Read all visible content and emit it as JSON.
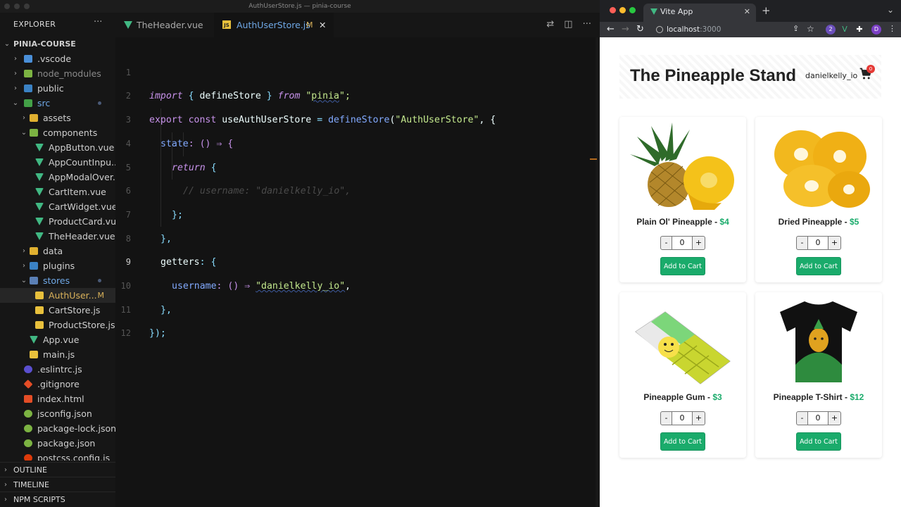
{
  "vscode": {
    "window_title": "AuthUserStore.js — pinia-course",
    "explorer_title": "EXPLORER",
    "project": "PINIA-COURSE",
    "tree": [
      {
        "label": ".vscode"
      },
      {
        "label": "node_modules"
      },
      {
        "label": "public"
      },
      {
        "label": "src"
      },
      {
        "label": "assets"
      },
      {
        "label": "components"
      },
      {
        "label": "AppButton.vue"
      },
      {
        "label": "AppCountInpu..."
      },
      {
        "label": "AppModalOver..."
      },
      {
        "label": "CartItem.vue"
      },
      {
        "label": "CartWidget.vue"
      },
      {
        "label": "ProductCard.vue"
      },
      {
        "label": "TheHeader.vue"
      },
      {
        "label": "data"
      },
      {
        "label": "plugins"
      },
      {
        "label": "stores"
      },
      {
        "label": "AuthUser...",
        "badge": "M"
      },
      {
        "label": "CartStore.js"
      },
      {
        "label": "ProductStore.js"
      },
      {
        "label": "App.vue"
      },
      {
        "label": "main.js"
      },
      {
        "label": ".eslintrc.js"
      },
      {
        "label": ".gitignore"
      },
      {
        "label": "index.html"
      },
      {
        "label": "jsconfig.json"
      },
      {
        "label": "package-lock.json"
      },
      {
        "label": "package.json"
      },
      {
        "label": "postcss.config.js"
      }
    ],
    "sections": [
      "OUTLINE",
      "TIMELINE",
      "NPM SCRIPTS"
    ],
    "tabs": [
      {
        "label": "TheHeader.vue"
      },
      {
        "label": "AuthUserStore.js",
        "badge": "M"
      }
    ],
    "line_numbers": [
      "1",
      "2",
      "3",
      "4",
      "5",
      "6",
      "7",
      "8",
      "9",
      "10",
      "11",
      "12"
    ],
    "code": {
      "l1_import": "import",
      "l1_open": " { ",
      "l1_name": "defineStore",
      "l1_close": " } ",
      "l1_from": "from",
      "l1_q1": " \"",
      "l1_mod": "pinia",
      "l1_q2": "\";",
      "l2_export": "export",
      "l2_const": " const ",
      "l2_name": "useAuthUserStore",
      "l2_eq": " = ",
      "l2_fn": "defineStore",
      "l2_paren": "(",
      "l2_str": "\"AuthUserStore\"",
      "l2_rest": ", {",
      "l3_state": "state",
      "l3_rest": ": () ⇒ {",
      "l4_return": "return",
      "l4_rest": " {",
      "l5_comment": "// username: \"danielkelly_io\",",
      "l6": "};",
      "l7": "},",
      "l8_getters": "getters",
      "l8_rest": ": {",
      "l9_user": "username",
      "l9_mid": ": () ⇒ ",
      "l9_str": "\"danielkelly_io\"",
      "l9_end": ",",
      "l10": "},",
      "l11": "});"
    }
  },
  "browser": {
    "tab_title": "Vite App",
    "url_host": "localhost",
    "url_port": ":3000",
    "site_title": "The Pineapple Stand",
    "username": "danielkelly_io",
    "cart_count": "0",
    "products": [
      {
        "name": "Plain Ol' Pineapple - ",
        "price": "$4",
        "qty": "0",
        "button": "Add to Cart"
      },
      {
        "name": "Dried Pineapple - ",
        "price": "$5",
        "qty": "0",
        "button": "Add to Cart"
      },
      {
        "name": "Pineapple Gum - ",
        "price": "$3",
        "qty": "0",
        "button": "Add to Cart"
      },
      {
        "name": "Pineapple T-Shirt - ",
        "price": "$12",
        "qty": "0",
        "button": "Add to Cart"
      }
    ],
    "counter_minus": "-",
    "counter_plus": "+"
  },
  "colors": {
    "accent_green": "#1aab6b",
    "vue_green": "#41b883",
    "js_yellow": "#e8c03c"
  }
}
